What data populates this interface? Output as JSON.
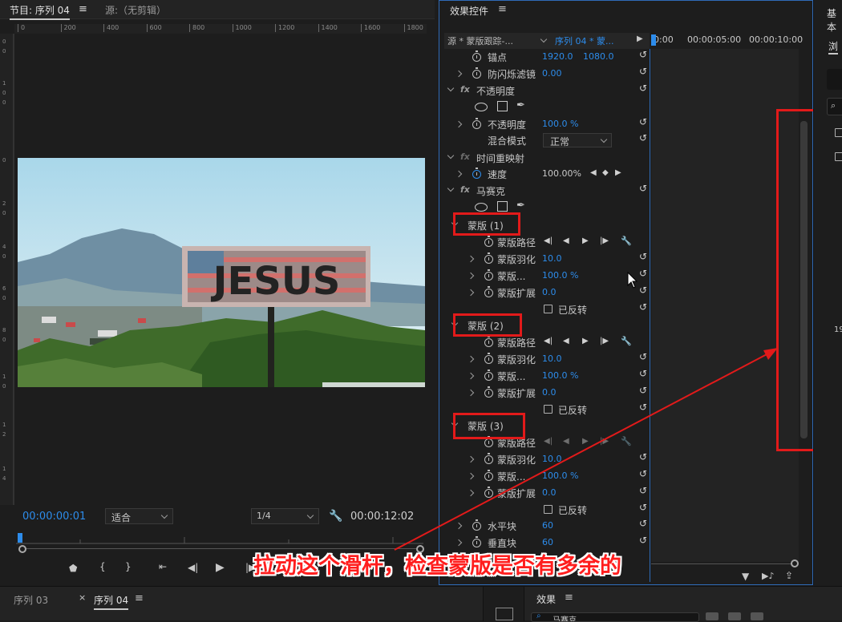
{
  "program_monitor": {
    "tab_program": "节目: 序列 04",
    "tab_source": "源:（无剪辑）",
    "ruler_ticks": [
      "0",
      "200",
      "400",
      "600",
      "800",
      "1000",
      "1200",
      "1400",
      "1600",
      "1800"
    ],
    "sign_text": "JESUS",
    "current_time": "00:00:00:01",
    "zoom": "适合",
    "resolution": "1/4",
    "duration": "00:00:12:02"
  },
  "effect_controls": {
    "title": "效果控件",
    "source_label": "源 * 蒙版跟踪-...",
    "sequence_label": "序列 04 * 蒙...",
    "timecodes": [
      "0:00",
      "00:00:05:00",
      "00:00:10:00"
    ],
    "anchor": {
      "label": "锚点",
      "x": "1920.0",
      "y": "1080.0"
    },
    "anti_flicker": {
      "label": "防闪烁滤镜",
      "value": "0.00"
    },
    "opacity_group": "不透明度",
    "opacity": {
      "label": "不透明度",
      "value": "100.0 %"
    },
    "blend": {
      "label": "混合模式",
      "value": "正常"
    },
    "time_remap": "时间重映射",
    "speed": {
      "label": "速度",
      "value": "100.00%"
    },
    "mosaic": "马赛克",
    "masks": [
      {
        "name": "蒙版 (1)",
        "path": "蒙版路径",
        "feather": "蒙版羽化",
        "feather_val": "10.0",
        "opacity": "蒙版...",
        "opacity_val": "100.0 %",
        "expand": "蒙版扩展",
        "expand_val": "0.0",
        "inverted": "已反转"
      },
      {
        "name": "蒙版 (2)",
        "path": "蒙版路径",
        "feather": "蒙版羽化",
        "feather_val": "10.0",
        "opacity": "蒙版...",
        "opacity_val": "100.0 %",
        "expand": "蒙版扩展",
        "expand_val": "0.0",
        "inverted": "已反转"
      },
      {
        "name": "蒙版 (3)",
        "path": "蒙版路径",
        "feather": "蒙版羽化",
        "feather_val": "10.0",
        "opacity": "蒙版...",
        "opacity_val": "100.0 %",
        "expand": "蒙版扩展",
        "expand_val": "0.0",
        "inverted": "已反转"
      }
    ],
    "h_blocks": {
      "label": "水平块",
      "value": "60"
    },
    "v_blocks": {
      "label": "垂直块",
      "value": "60"
    }
  },
  "right_panel": {
    "title": "基本",
    "tab": "浏",
    "number": "19"
  },
  "bottom": {
    "tab1": "序列 03",
    "tab2": "序列 04",
    "effects": "效果",
    "search": "马赛克"
  },
  "annotation": "拉动这个滑杆，检查蒙版是否有多余的",
  "colors": {
    "accent": "#2d8ceb",
    "annotation": "#e21a1a"
  }
}
